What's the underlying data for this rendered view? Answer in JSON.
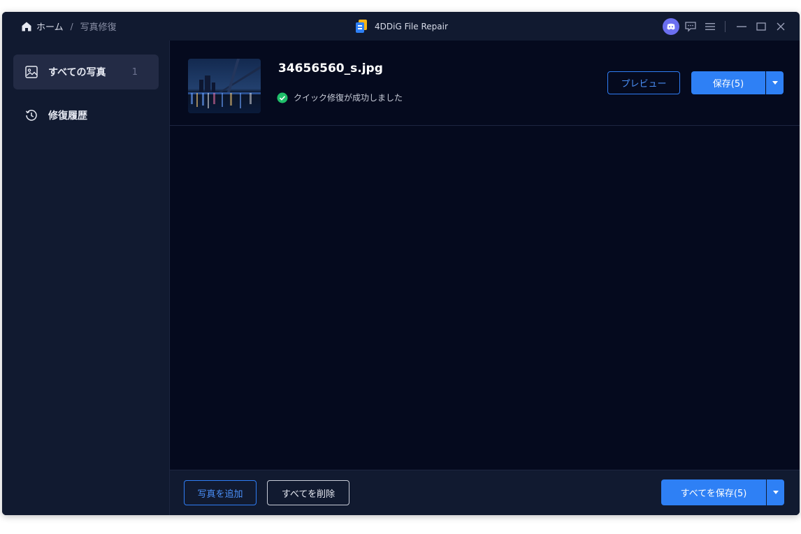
{
  "breadcrumb": {
    "home_label": "ホーム",
    "separator": "/",
    "current": "写真修復"
  },
  "app": {
    "title": "4DDiG File Repair"
  },
  "sidebar": {
    "items": [
      {
        "label": "すべての写真",
        "count": "1",
        "icon": "image-icon"
      },
      {
        "label": "修復履歴",
        "icon": "history-icon"
      }
    ]
  },
  "file": {
    "name": "34656560_s.jpg",
    "status": "クイック修復が成功しました"
  },
  "actions": {
    "preview_label": "プレビュー",
    "save_label": "保存(5)"
  },
  "footer": {
    "add_label": "写真を追加",
    "delete_all_label": "すべてを削除",
    "save_all_label": "すべてを保存(5)"
  },
  "colors": {
    "accent": "#2e80f5",
    "success": "#1fbf6a",
    "background": "#050a1e",
    "panel": "#111a30"
  }
}
